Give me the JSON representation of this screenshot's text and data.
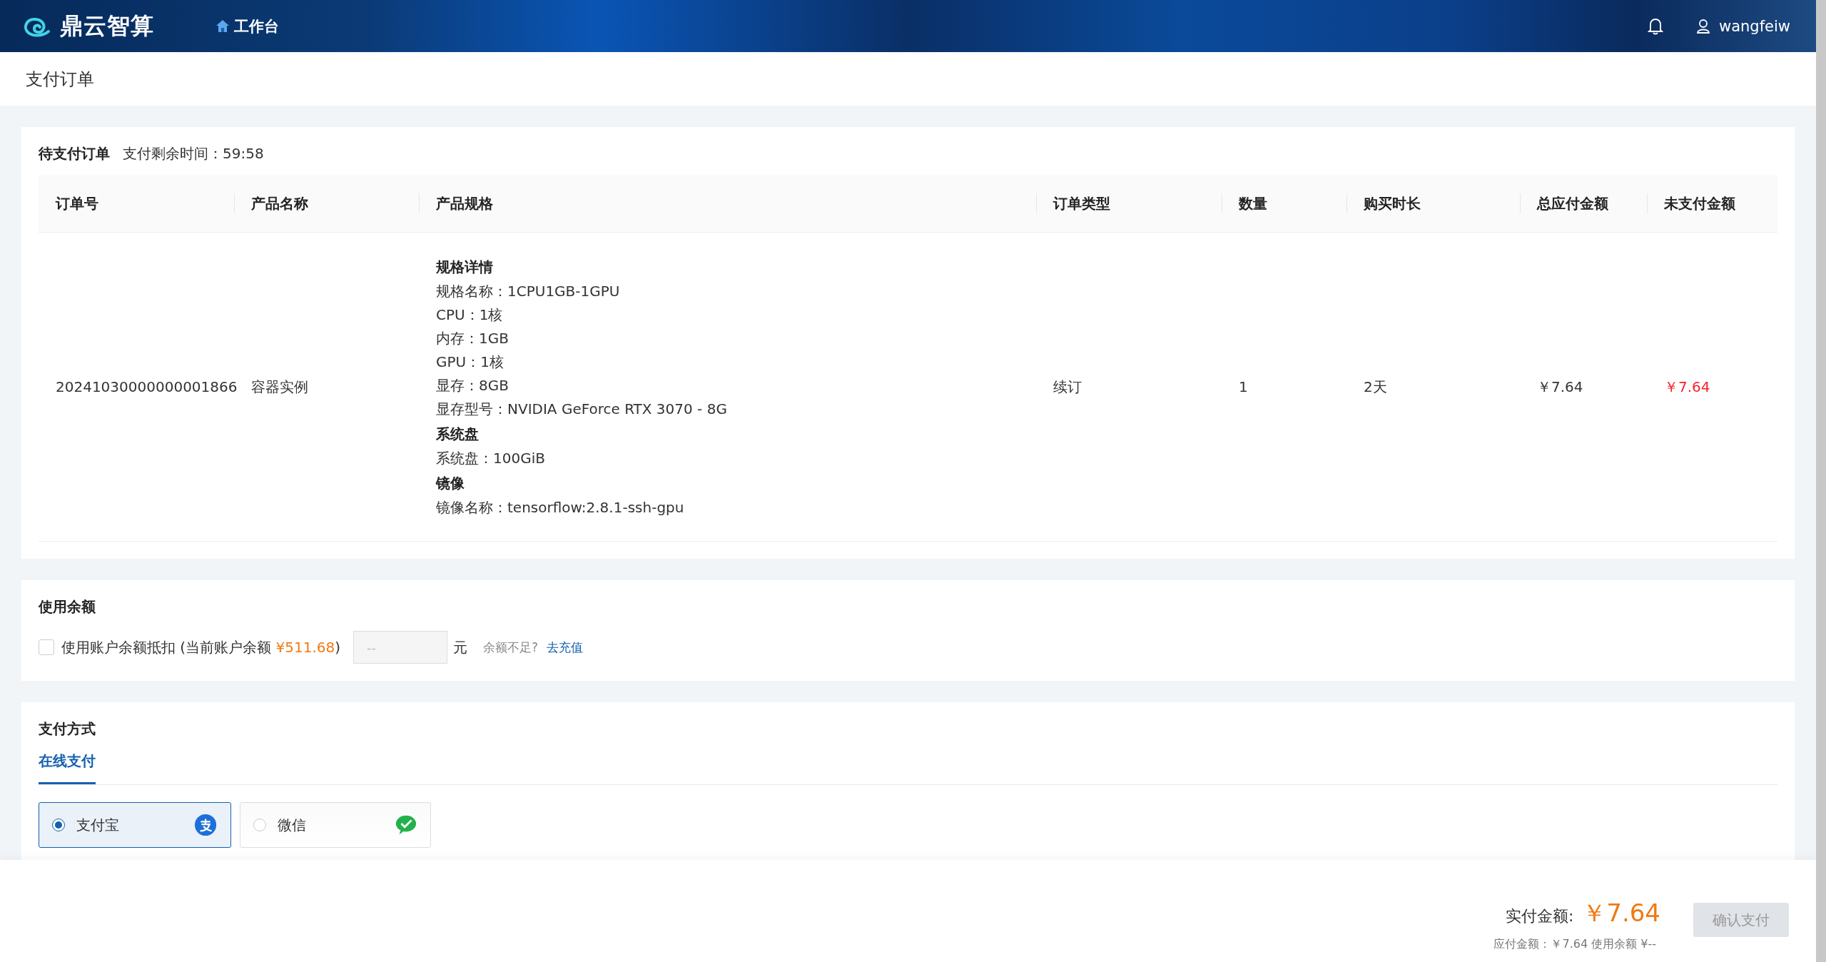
{
  "header": {
    "logo_text": "鼎云智算",
    "nav": [
      {
        "label": "工作台",
        "selected": true
      }
    ],
    "username": "wangfeiw"
  },
  "page_title": "支付订单",
  "order": {
    "title": "待支付订单",
    "countdown": "支付剩余时间：59:58",
    "columns": [
      "订单号",
      "产品名称",
      "产品规格",
      "订单类型",
      "数量",
      "购买时长",
      "总应付金额",
      "未支付金额"
    ],
    "rows": [
      {
        "order_no": "20241030000000001866",
        "product": "容器实例",
        "spec": [
          {
            "kind": "heading",
            "text": "规格详情"
          },
          {
            "kind": "line",
            "text": "规格名称：1CPU1GB-1GPU"
          },
          {
            "kind": "line",
            "text": "CPU：1核"
          },
          {
            "kind": "line",
            "text": "内存：1GB"
          },
          {
            "kind": "line",
            "text": "GPU：1核"
          },
          {
            "kind": "line",
            "text": "显存：8GB"
          },
          {
            "kind": "line",
            "text": "显存型号：NVIDIA GeForce RTX 3070 - 8G"
          },
          {
            "kind": "heading",
            "text": "系统盘"
          },
          {
            "kind": "line",
            "text": "系统盘：100GiB"
          },
          {
            "kind": "heading",
            "text": "镜像"
          },
          {
            "kind": "line",
            "text": "镜像名称：tensorflow:2.8.1-ssh-gpu"
          }
        ],
        "order_type": "续订",
        "quantity": "1",
        "duration": "2天",
        "total": "￥7.64",
        "unpaid": "￥7.64"
      }
    ]
  },
  "balance": {
    "title": "使用余额",
    "checked": false,
    "label_prefix": "使用账户余额抵扣 (当前账户余额 ",
    "amount": "¥511.68",
    "label_suffix": ")",
    "placeholder": "--",
    "unit": "元",
    "hint": "余额不足?",
    "link": "去充值"
  },
  "payment": {
    "title": "支付方式",
    "tabs": [
      {
        "label": "在线支付",
        "selected": true
      }
    ],
    "methods": [
      {
        "label": "支付宝",
        "kind": "alipay",
        "selected": true
      },
      {
        "label": "微信",
        "kind": "wechat",
        "selected": false
      }
    ]
  },
  "footer": {
    "actual_label": "实付金额:",
    "actual_amount": "￥7.64",
    "summary": "应付金额：￥7.64 使用余额 ¥--",
    "button": {
      "label": "确认支付",
      "disabled": true
    }
  }
}
